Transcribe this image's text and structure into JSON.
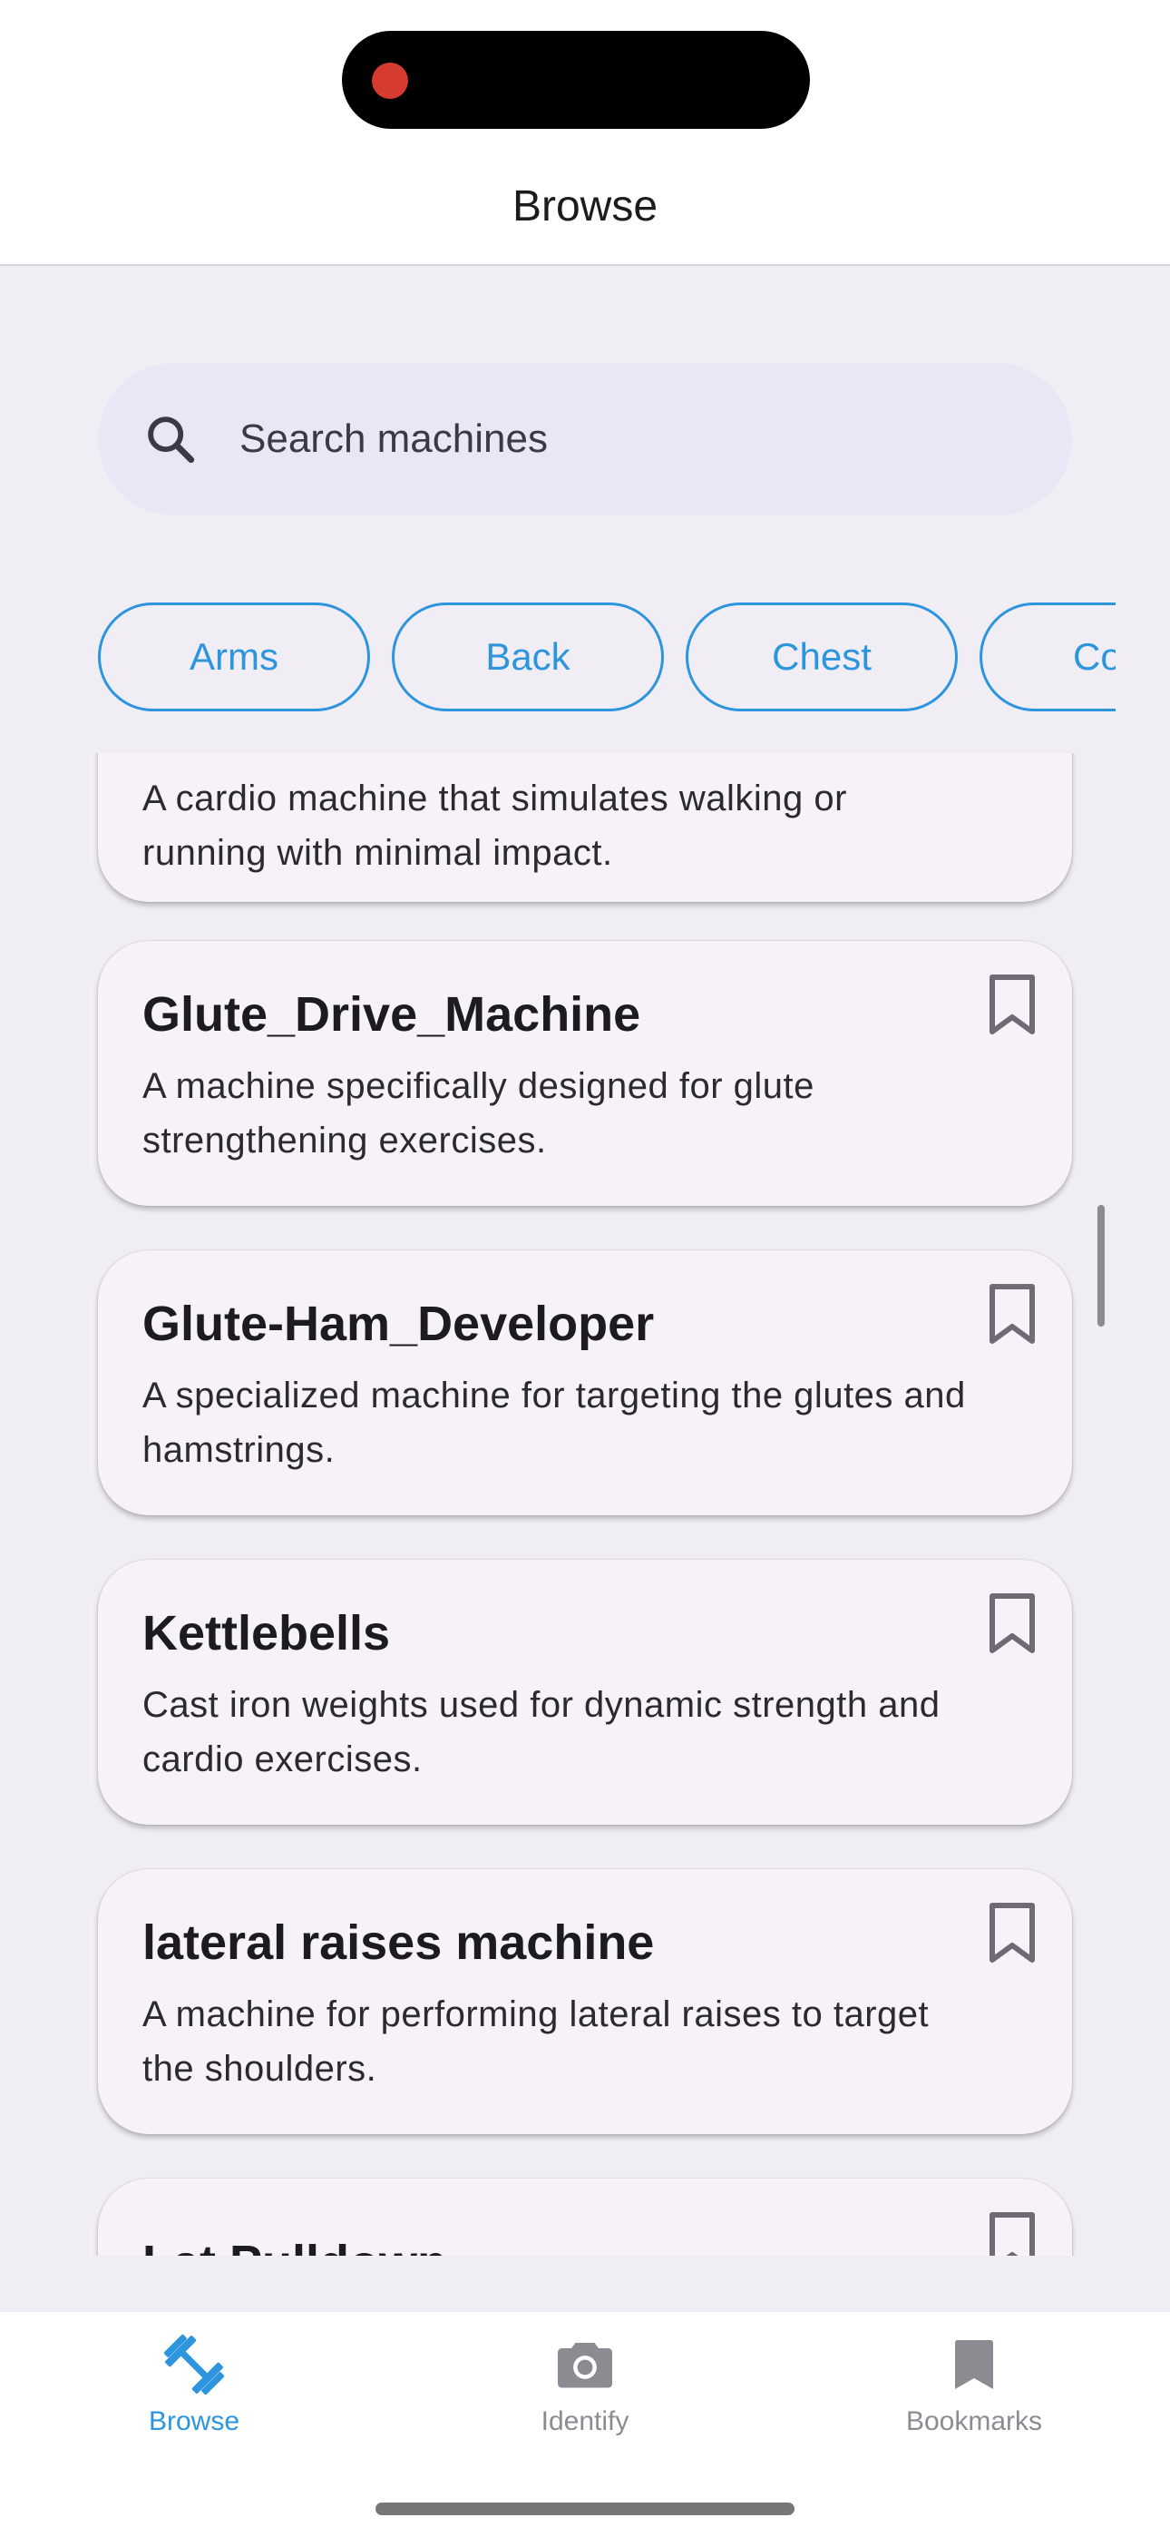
{
  "header": {
    "title": "Browse"
  },
  "search": {
    "placeholder": "Search machines",
    "value": ""
  },
  "chips": [
    {
      "label": "Arms"
    },
    {
      "label": "Back"
    },
    {
      "label": "Chest"
    },
    {
      "label": "Co"
    }
  ],
  "cards": [
    {
      "title": "",
      "description": "A cardio machine that simulates walking or running with minimal impact."
    },
    {
      "title": "Glute_Drive_Machine",
      "description": "A machine specifically designed for glute strengthening exercises."
    },
    {
      "title": "Glute-Ham_Developer",
      "description": "A specialized machine for targeting the glutes and hamstrings."
    },
    {
      "title": "Kettlebells",
      "description": "Cast iron weights used for dynamic strength and cardio exercises."
    },
    {
      "title": "lateral raises machine",
      "description": "A machine for performing lateral raises to target the shoulders."
    },
    {
      "title": "Lat Pulldown",
      "description": ""
    }
  ],
  "bottom_nav": [
    {
      "label": "Browse",
      "icon": "dumbbell-icon",
      "active": true
    },
    {
      "label": "Identify",
      "icon": "camera-icon",
      "active": false
    },
    {
      "label": "Bookmarks",
      "icon": "bookmark-icon",
      "active": false
    }
  ],
  "colors": {
    "accent": "#2d95dd",
    "inactive": "#8d8b92",
    "card_bg": "#f7f2fa",
    "search_bg": "#ebe6f5",
    "page_bg": "#f0eef4"
  }
}
